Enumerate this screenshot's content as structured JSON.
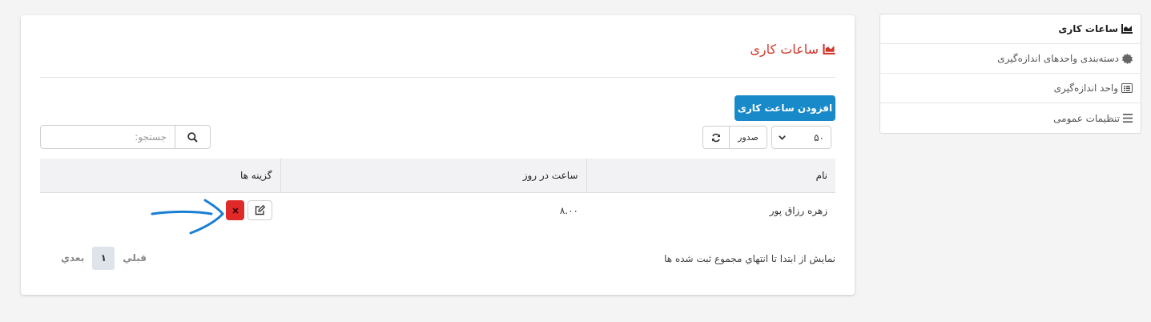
{
  "sidebar": {
    "items": [
      {
        "label": "ساعات کاری",
        "icon": "chart-area-icon",
        "active": true
      },
      {
        "label": "دسته‌بندی واحدهای اندازه‌گیری",
        "icon": "certificate-icon"
      },
      {
        "label": "واحد اندازه‌گیری",
        "icon": "list-alt-icon"
      },
      {
        "label": "تنظیمات عمومی",
        "icon": "bars-icon"
      }
    ]
  },
  "main": {
    "title": "ساعات کاری",
    "title_icon": "chart-area-icon",
    "add_button": "افزودن ساعت کاری",
    "page_size": "۵۰",
    "export_label": "صدور",
    "search_placeholder": "جستجو:",
    "search_value": "",
    "table": {
      "headers": {
        "name": "نام",
        "hours": "ساعت در روز",
        "options": "گزینه ها"
      },
      "rows": [
        {
          "name": "زهره رزاق پور",
          "hours": "۸.۰۰"
        }
      ]
    },
    "info": "نمایش از ابتدا تا انتهاي مجموع ثبت شده ها",
    "pager": {
      "prev": "قبلي",
      "current": "۱",
      "next": "بعدي"
    }
  },
  "colors": {
    "accent": "#1889c9",
    "title": "#d0382b",
    "delete": "#e02a2a",
    "annotation": "#1a7fd4"
  }
}
